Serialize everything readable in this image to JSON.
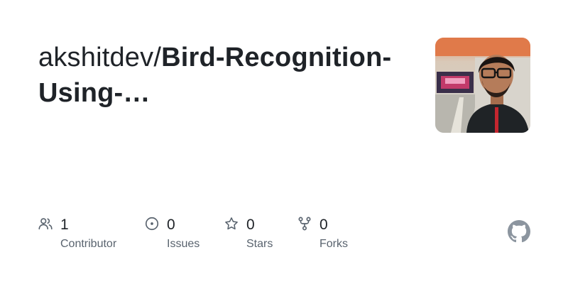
{
  "repo": {
    "owner_prefix": "akshitdev/",
    "name": "Bird-Recognition-Using-…"
  },
  "avatar": {
    "alt": "akshitdev avatar"
  },
  "stats": [
    {
      "value": "1",
      "label": "Contributor",
      "icon": "people-icon"
    },
    {
      "value": "0",
      "label": "Issues",
      "icon": "issue-opened-icon"
    },
    {
      "value": "0",
      "label": "Stars",
      "icon": "star-icon"
    },
    {
      "value": "0",
      "label": "Forks",
      "icon": "fork-icon"
    }
  ],
  "colors": {
    "text": "#1f2328",
    "muted": "#59636e",
    "icon": "#59636e",
    "logo": "#8c959f"
  }
}
